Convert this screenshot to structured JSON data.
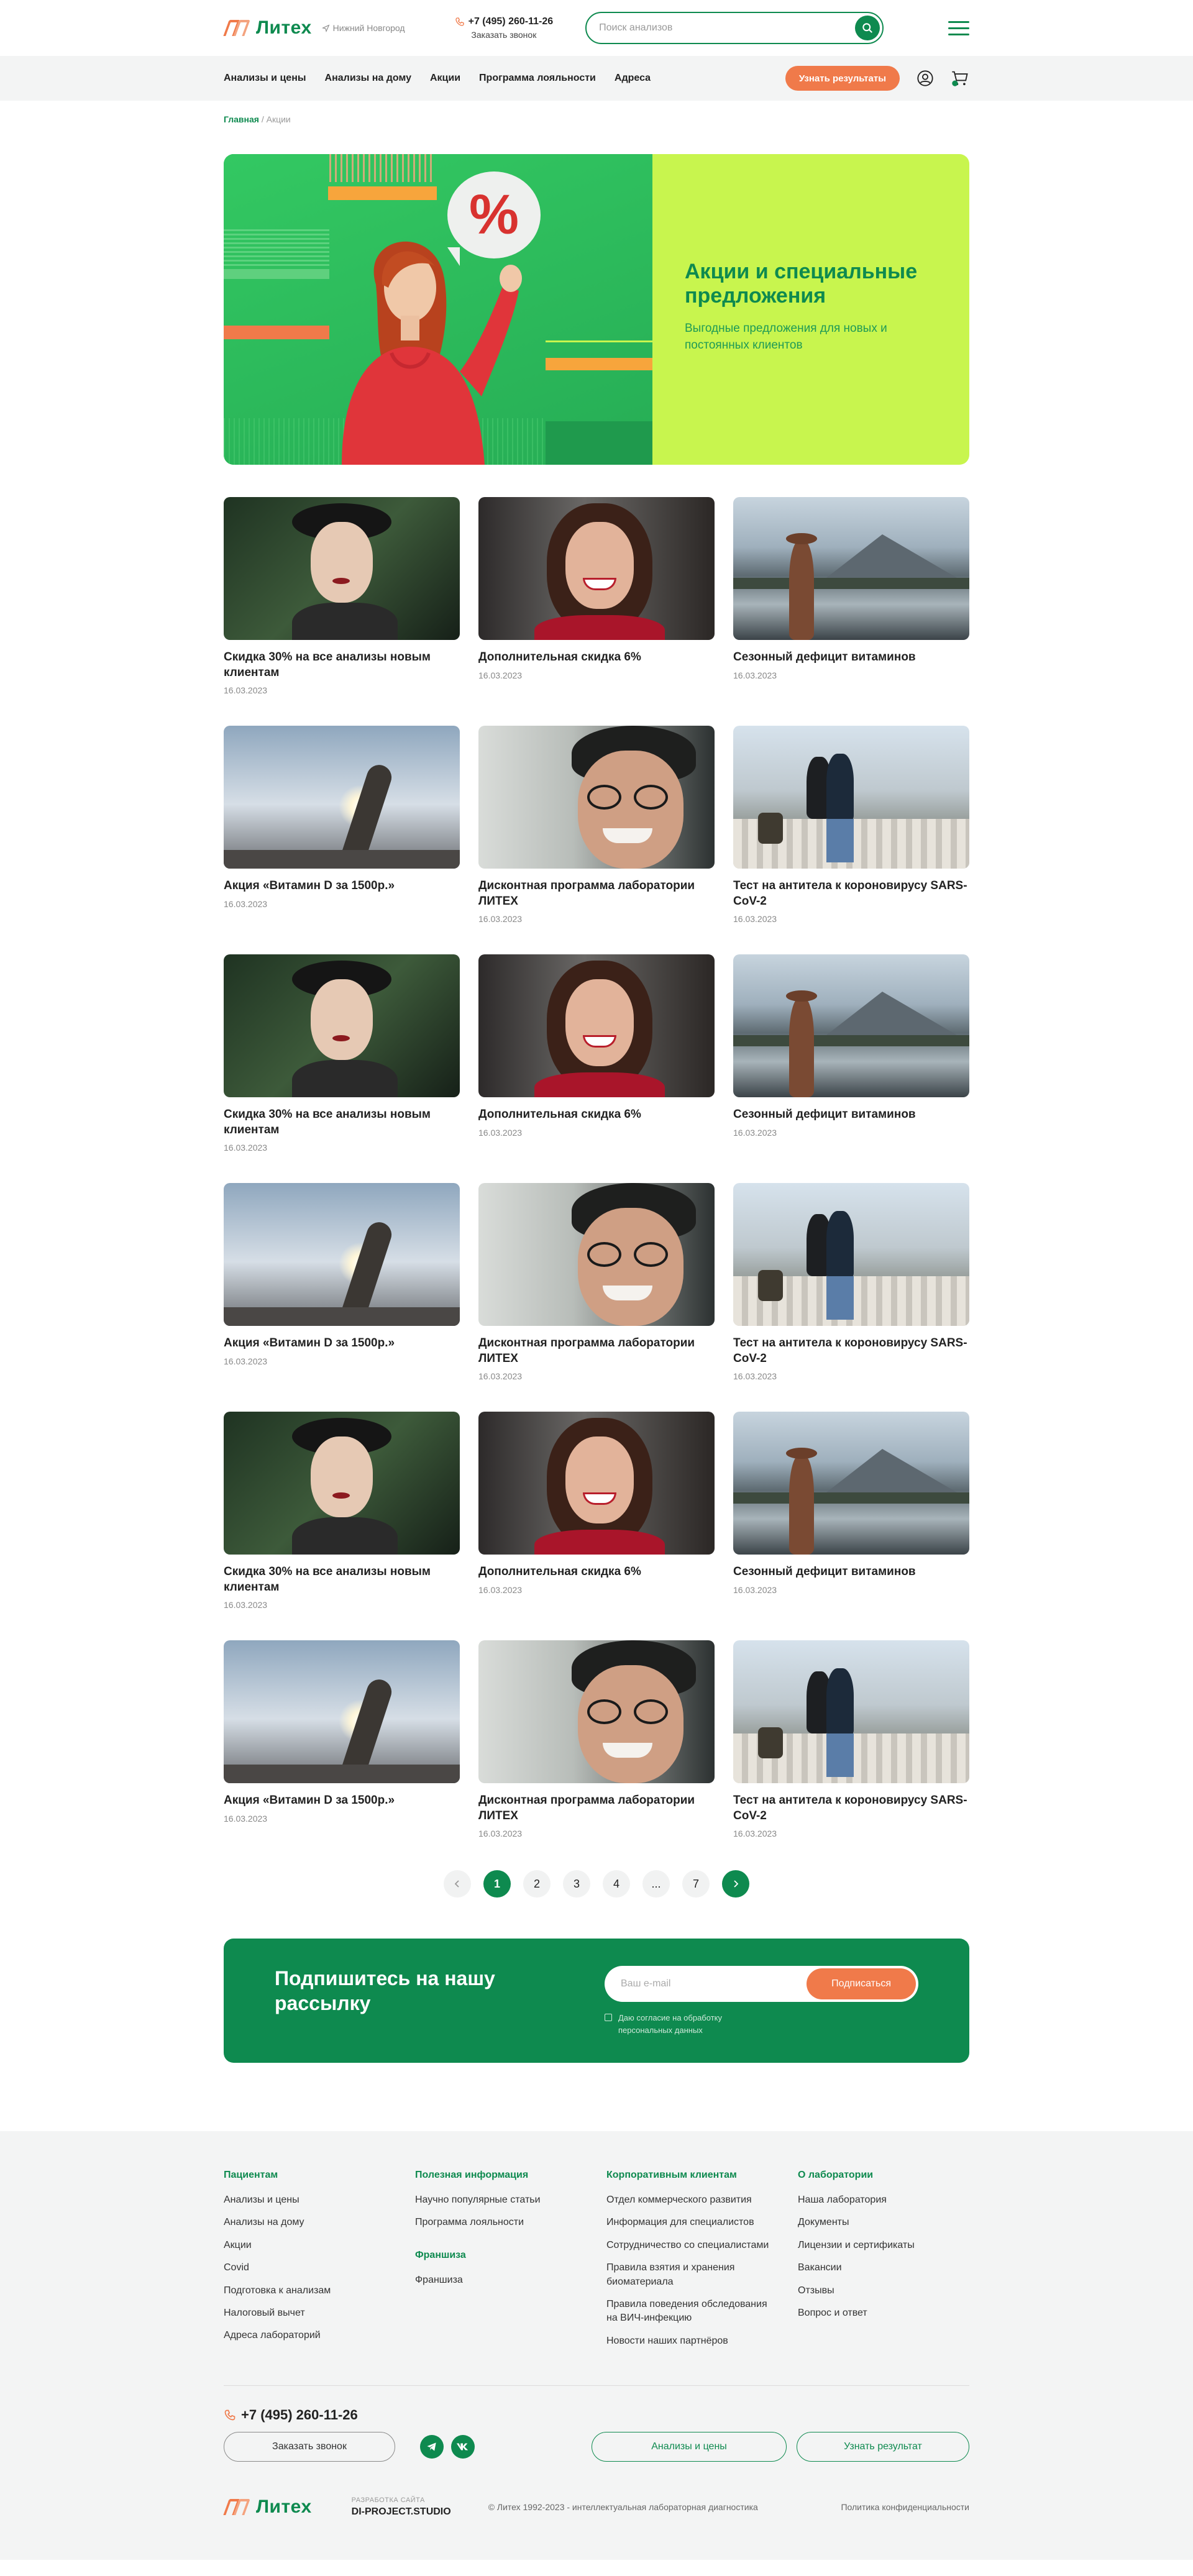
{
  "header": {
    "logo_text": "Литех",
    "city": "Нижний Новгород",
    "phone": "+7 (495) 260-11-26",
    "call_label": "Заказать звонок",
    "search_placeholder": "Поиск анализов"
  },
  "nav": {
    "items": [
      "Анализы и цены",
      "Анализы на дому",
      "Акции",
      "Программа лояльности",
      "Адреса"
    ],
    "cta": "Узнать результаты"
  },
  "breadcrumb": {
    "home": "Главная",
    "separator": "/",
    "current": "Акции"
  },
  "hero": {
    "title": "Акции и специальные предложения",
    "subtitle": "Выгодные предложения для новых и постоянных клиентов",
    "badge": "%"
  },
  "cards": [
    {
      "title": "Скидка 30% на все анализы новым клиентам",
      "date": "16.03.2023",
      "image": "woman-hat"
    },
    {
      "title": "Дополнительная скидка 6%",
      "date": "16.03.2023",
      "image": "woman-smile"
    },
    {
      "title": "Сезонный дефицит витаминов",
      "date": "16.03.2023",
      "image": "lake-mountains"
    },
    {
      "title": "Акция «Витамин D за 1500р.»",
      "date": "16.03.2023",
      "image": "sun-hand"
    },
    {
      "title": "Дисконтная программа лаборатории ЛИТЕХ",
      "date": "16.03.2023",
      "image": "man-glasses"
    },
    {
      "title": "Тест на антитела к короновирусу SARS-CoV-2",
      "date": "16.03.2023",
      "image": "couple-city"
    },
    {
      "title": "Скидка 30% на все анализы новым клиентам",
      "date": "16.03.2023",
      "image": "woman-hat"
    },
    {
      "title": "Дополнительная скидка 6%",
      "date": "16.03.2023",
      "image": "woman-smile"
    },
    {
      "title": "Сезонный дефицит витаминов",
      "date": "16.03.2023",
      "image": "lake-mountains"
    },
    {
      "title": "Акция «Витамин D за 1500р.»",
      "date": "16.03.2023",
      "image": "sun-hand"
    },
    {
      "title": "Дисконтная программа лаборатории ЛИТЕХ",
      "date": "16.03.2023",
      "image": "man-glasses"
    },
    {
      "title": "Тест на антитела к короновирусу SARS-CoV-2",
      "date": "16.03.2023",
      "image": "couple-city"
    },
    {
      "title": "Скидка 30% на все анализы новым клиентам",
      "date": "16.03.2023",
      "image": "woman-hat"
    },
    {
      "title": "Дополнительная скидка 6%",
      "date": "16.03.2023",
      "image": "woman-smile"
    },
    {
      "title": "Сезонный дефицит витаминов",
      "date": "16.03.2023",
      "image": "lake-mountains"
    },
    {
      "title": "Акция «Витамин D за 1500р.»",
      "date": "16.03.2023",
      "image": "sun-hand"
    },
    {
      "title": "Дисконтная программа лаборатории ЛИТЕХ",
      "date": "16.03.2023",
      "image": "man-glasses"
    },
    {
      "title": "Тест на антитела к короновирусу SARS-CoV-2",
      "date": "16.03.2023",
      "image": "couple-city"
    }
  ],
  "pagination": {
    "pages": [
      "1",
      "2",
      "3",
      "4",
      "...",
      "7"
    ],
    "active": "1"
  },
  "subscribe": {
    "title": "Подпишитесь на нашу рассылку",
    "placeholder": "Ваш e-mail",
    "button": "Подписаться",
    "consent": "Даю согласие на обработку персональных данных"
  },
  "footer": {
    "columns": [
      {
        "heading": "Пациентам",
        "items": [
          "Анализы и цены",
          "Анализы на дому",
          "Акции",
          "Covid",
          "Подготовка к анализам",
          "Налоговый вычет",
          "Адреса лабораторий"
        ]
      },
      {
        "heading": "Полезная информация",
        "items": [
          "Научно популярные статьи",
          "Программа лояльности"
        ],
        "heading2": "Франшиза",
        "items2": [
          "Франшиза"
        ]
      },
      {
        "heading": "Корпоративным клиентам",
        "items": [
          "Отдел коммерческого развития",
          "Информация для специалистов",
          "Сотрудничество со специалистами",
          "Правила взятия и хранения биоматериала",
          "Правила поведения обследования на ВИЧ-инфекцию",
          "Новости наших партнёров"
        ]
      },
      {
        "heading": "О лаборатории",
        "items": [
          "Наша лаборатория",
          "Документы",
          "Лицензии и сертификаты",
          "Вакансии",
          "Отзывы",
          "Вопрос и ответ"
        ]
      }
    ],
    "phone": "+7 (495) 260-11-26",
    "call_button": "Заказать звонок",
    "prices_button": "Анализы и цены",
    "results_button": "Узнать результат",
    "dev_label": "РАЗРАБОТКА САЙТА",
    "dev_name": "DI-PROJECT.STUDIO",
    "copyright": "© Литех 1992-2023 - интеллектуальная лабораторная диагностика",
    "policy": "Политика конфиденциальности"
  },
  "colors": {
    "brand_green": "#0e8a4f",
    "accent_orange": "#f07a4a",
    "hero_lime": "#c8f54e",
    "hero_green": "#2ebc5c"
  },
  "icons": [
    "location-arrow-icon",
    "phone-icon",
    "search-icon",
    "burger-menu-icon",
    "user-icon",
    "cart-icon",
    "chevron-left-icon",
    "chevron-right-icon",
    "checkbox-icon",
    "telegram-icon",
    "vk-icon"
  ]
}
